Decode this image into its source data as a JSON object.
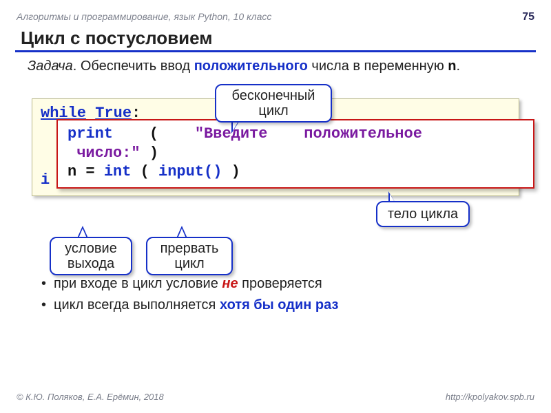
{
  "header": {
    "breadcrumb": "Алгоритмы и программирование, язык Python, 10 класс",
    "page_number": "75"
  },
  "title": "Цикл с постусловием",
  "task": {
    "prefix_italic": "Задача",
    "text1": ". Обеспечить ввод ",
    "keyword": "положительного",
    "text2": " числа в переменную ",
    "var": "n",
    "text3": "."
  },
  "code": {
    "line1_while": "while",
    "line1_true": "True",
    "line1_colon": ":",
    "inner_print": "print",
    "inner_open": "(",
    "inner_str1": "\"Введите",
    "inner_str2": "положительное",
    "inner_str3": "число:\"",
    "inner_close": ")",
    "inner2_n": "n",
    "inner2_eq": "=",
    "inner2_int": "int",
    "inner2_open": "(",
    "inner2_input": "input()",
    "inner2_close": ")",
    "line3_i": "i"
  },
  "callouts": {
    "c1": "бесконечный цикл",
    "c2": "тело цикла",
    "c3": "условие выхода",
    "c4": "прервать цикл"
  },
  "bullets": {
    "b1_pre": "при входе в цикл условие ",
    "b1_em": "не",
    "b1_post": " проверяется",
    "b2_pre": "цикл всегда выполняется ",
    "b2_em": "хотя бы один раз"
  },
  "footer": {
    "left": "© К.Ю. Поляков, Е.А. Ерёмин, 2018",
    "right": "http://kpolyakov.spb.ru"
  }
}
